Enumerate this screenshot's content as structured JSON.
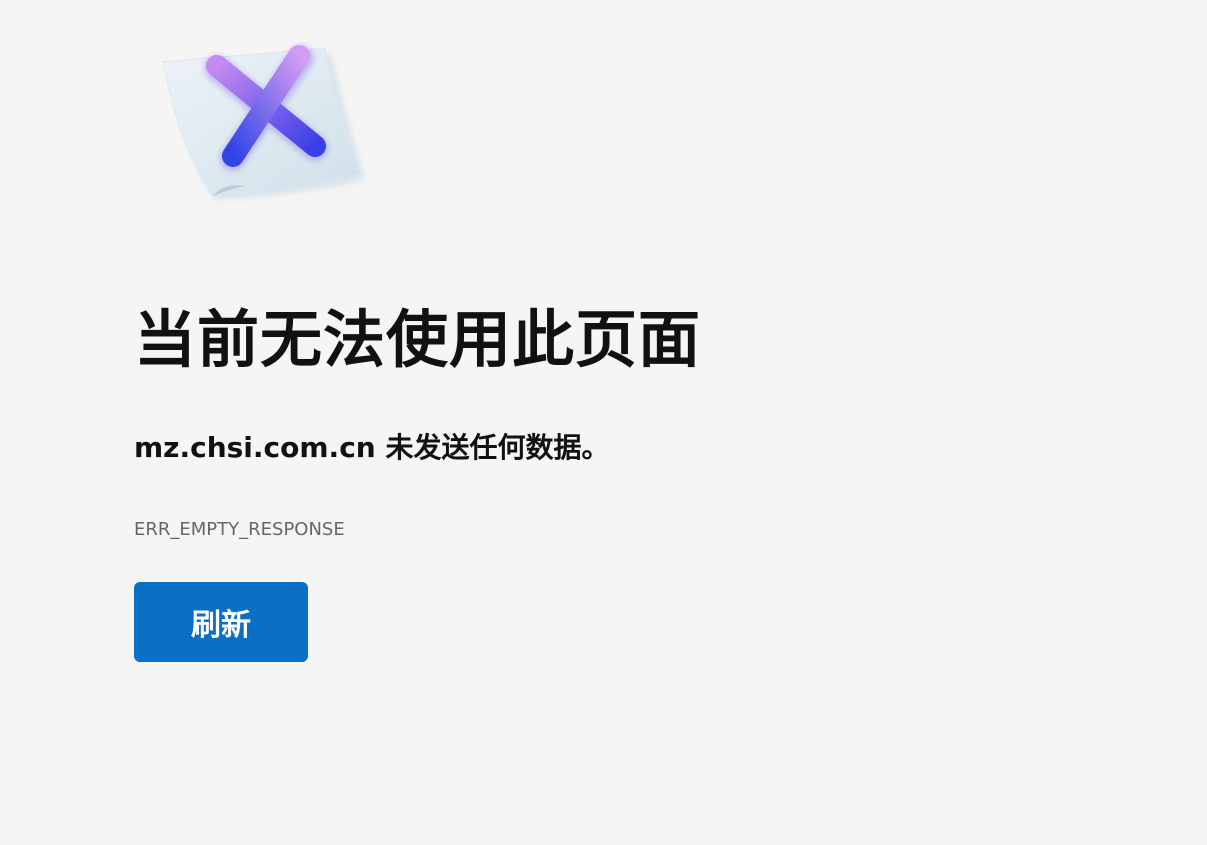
{
  "error_page": {
    "title": "当前无法使用此页面",
    "subtitle": "mz.chsi.com.cn 未发送任何数据。",
    "error_code": "ERR_EMPTY_RESPONSE",
    "refresh_label": "刷新",
    "illustration_icon": "document-x-icon"
  },
  "colors": {
    "background": "#f5f5f5",
    "title_text": "#111111",
    "error_code_text": "#666666",
    "button_background": "#0a6fc7",
    "button_text": "#ffffff",
    "x_gradient_start": "#c58af0",
    "x_gradient_end": "#2f43e6"
  }
}
